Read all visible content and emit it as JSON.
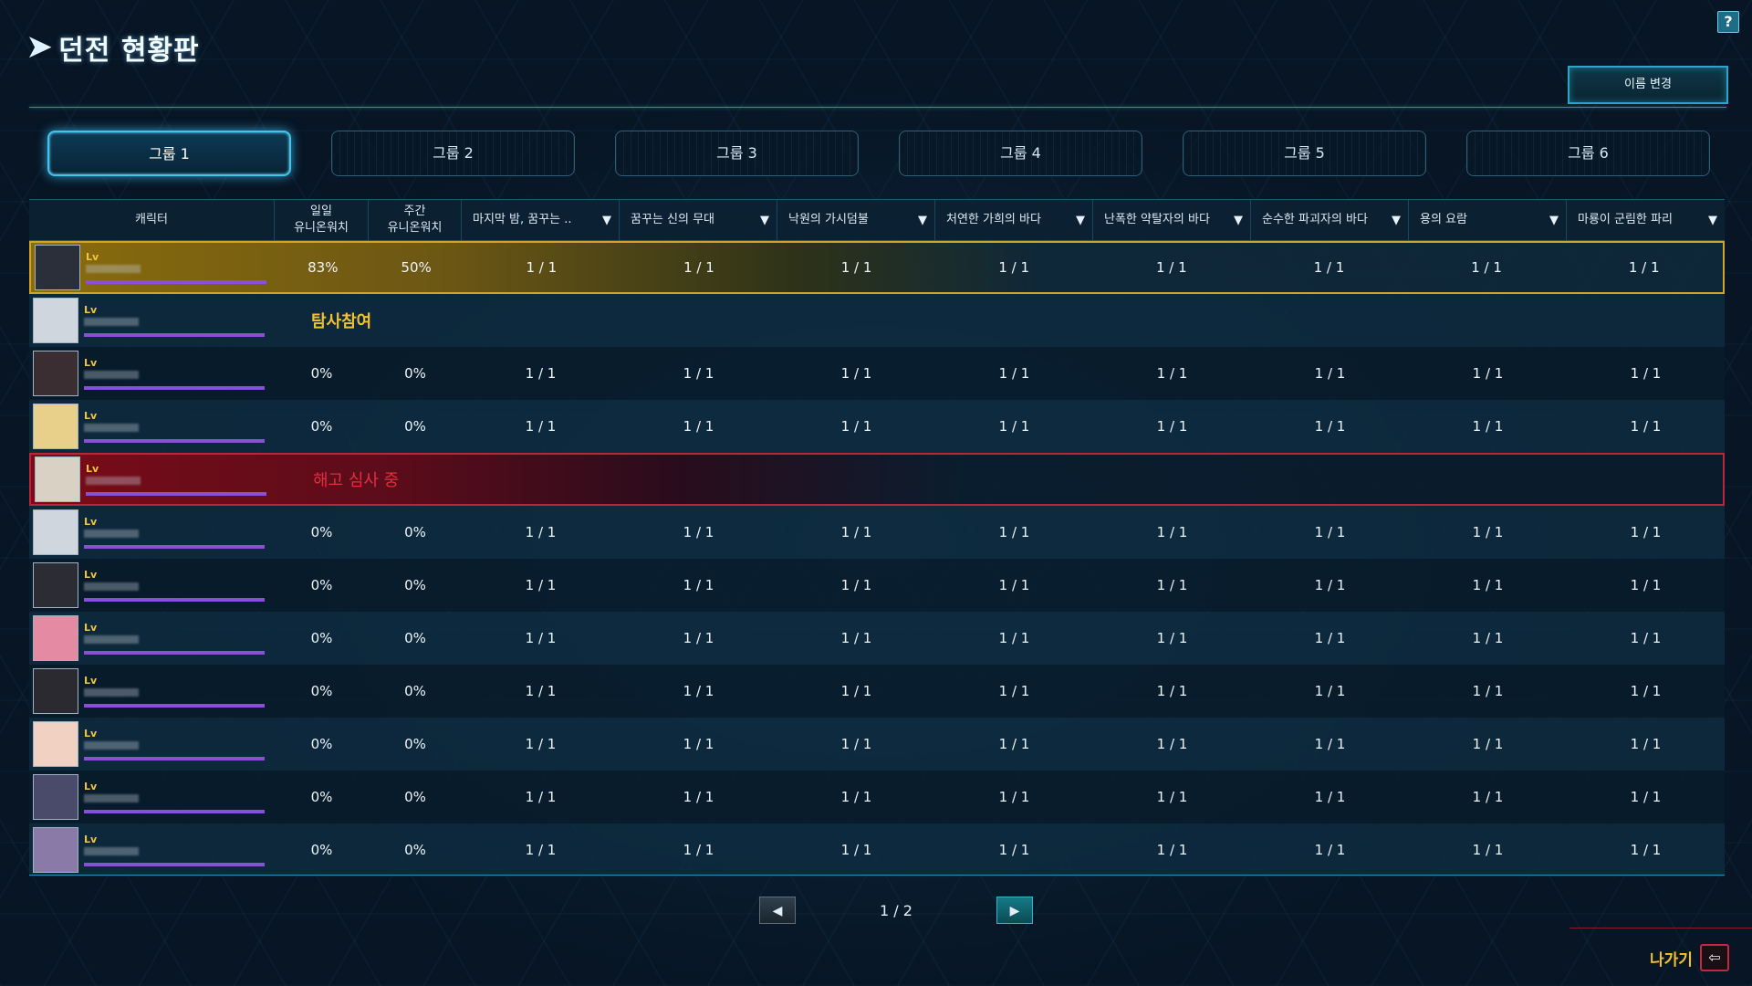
{
  "title": "던전 현황판",
  "help_label": "?",
  "rename_label": "이름 변경",
  "tabs": [
    {
      "label": "그룹 1",
      "active": true
    },
    {
      "label": "그룹 2"
    },
    {
      "label": "그룹 3"
    },
    {
      "label": "그룹 4"
    },
    {
      "label": "그룹 5"
    },
    {
      "label": "그룹 6"
    }
  ],
  "headers": {
    "character": "캐릭터",
    "daily": "일일\n유니온워치",
    "weekly": "주간\n유니온워치",
    "dungeons": [
      "마지막 밤, 꿈꾸는 ..",
      "꿈꾸는 신의 무대",
      "낙원의 가시덤불",
      "처연한 가희의 바다",
      "난폭한 약탈자의 바다",
      "순수한 파괴자의 바다",
      "용의 요람",
      "마룡이 군림한 파리"
    ]
  },
  "rows": [
    {
      "style": "gold",
      "lv": "Lv",
      "daily": "83%",
      "weekly": "50%",
      "values": [
        "1 / 1",
        "1 / 1",
        "1 / 1",
        "1 / 1",
        "1 / 1",
        "1 / 1",
        "1 / 1",
        "1 / 1"
      ],
      "avatar_color": "#2b2f3a"
    },
    {
      "style": "even",
      "lv": "Lv",
      "status": "탐사참여",
      "status_type": "gold",
      "avatar_color": "#cfd6de"
    },
    {
      "style": "odd",
      "lv": "Lv",
      "daily": "0%",
      "weekly": "0%",
      "values": [
        "1 / 1",
        "1 / 1",
        "1 / 1",
        "1 / 1",
        "1 / 1",
        "1 / 1",
        "1 / 1",
        "1 / 1"
      ],
      "avatar_color": "#3a2e33"
    },
    {
      "style": "even",
      "lv": "Lv",
      "daily": "0%",
      "weekly": "0%",
      "values": [
        "1 / 1",
        "1 / 1",
        "1 / 1",
        "1 / 1",
        "1 / 1",
        "1 / 1",
        "1 / 1",
        "1 / 1"
      ],
      "avatar_color": "#e8d08a"
    },
    {
      "style": "red",
      "lv": "Lv",
      "status": "해고 심사 중",
      "status_type": "red",
      "avatar_color": "#d9d2c4"
    },
    {
      "style": "even",
      "lv": "Lv",
      "daily": "0%",
      "weekly": "0%",
      "values": [
        "1 / 1",
        "1 / 1",
        "1 / 1",
        "1 / 1",
        "1 / 1",
        "1 / 1",
        "1 / 1",
        "1 / 1"
      ],
      "avatar_color": "#cfd6de"
    },
    {
      "style": "odd",
      "lv": "Lv",
      "daily": "0%",
      "weekly": "0%",
      "values": [
        "1 / 1",
        "1 / 1",
        "1 / 1",
        "1 / 1",
        "1 / 1",
        "1 / 1",
        "1 / 1",
        "1 / 1"
      ],
      "avatar_color": "#2c2c34"
    },
    {
      "style": "even",
      "lv": "Lv",
      "daily": "0%",
      "weekly": "0%",
      "values": [
        "1 / 1",
        "1 / 1",
        "1 / 1",
        "1 / 1",
        "1 / 1",
        "1 / 1",
        "1 / 1",
        "1 / 1"
      ],
      "avatar_color": "#e48aa2"
    },
    {
      "style": "odd",
      "lv": "Lv",
      "daily": "0%",
      "weekly": "0%",
      "values": [
        "1 / 1",
        "1 / 1",
        "1 / 1",
        "1 / 1",
        "1 / 1",
        "1 / 1",
        "1 / 1",
        "1 / 1"
      ],
      "avatar_color": "#2b2a30"
    },
    {
      "style": "even",
      "lv": "Lv",
      "daily": "0%",
      "weekly": "0%",
      "values": [
        "1 / 1",
        "1 / 1",
        "1 / 1",
        "1 / 1",
        "1 / 1",
        "1 / 1",
        "1 / 1",
        "1 / 1"
      ],
      "avatar_color": "#f1d2c2"
    },
    {
      "style": "odd",
      "lv": "Lv",
      "daily": "0%",
      "weekly": "0%",
      "values": [
        "1 / 1",
        "1 / 1",
        "1 / 1",
        "1 / 1",
        "1 / 1",
        "1 / 1",
        "1 / 1",
        "1 / 1"
      ],
      "avatar_color": "#4a4a6a"
    },
    {
      "style": "even",
      "lv": "Lv",
      "daily": "0%",
      "weekly": "0%",
      "values": [
        "1 / 1",
        "1 / 1",
        "1 / 1",
        "1 / 1",
        "1 / 1",
        "1 / 1",
        "1 / 1",
        "1 / 1"
      ],
      "avatar_color": "#8a7aa8"
    }
  ],
  "pager": {
    "prev": "◀",
    "text": "1 / 2",
    "next": "▶"
  },
  "exit_label": "나가기",
  "exit_icon": "exit-door-icon",
  "accent": "#3fc6f0",
  "gold": "#f2c12e",
  "red": "#e0303f"
}
